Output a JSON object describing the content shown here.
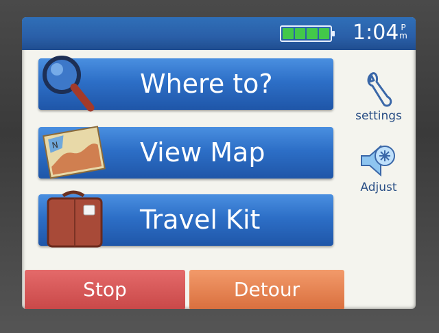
{
  "status": {
    "battery_level": 1.0,
    "time": "1:04",
    "ampm_top": "P",
    "ampm_bottom": "m"
  },
  "menu": [
    {
      "label": "Where to?",
      "icon": "magnifier-icon"
    },
    {
      "label": "View Map",
      "icon": "map-icon"
    },
    {
      "label": "Travel Kit",
      "icon": "suitcase-icon"
    }
  ],
  "side": {
    "settings_label": "settings",
    "adjust_label": "Adjust"
  },
  "bottom": {
    "stop_label": "Stop",
    "detour_label": "Detour"
  },
  "colors": {
    "statusbar": "#2a5fa8",
    "button_blue": "#2d6fc7",
    "stop_red": "#c94848",
    "detour_orange": "#d96f3e",
    "battery_green": "#43c84a"
  }
}
